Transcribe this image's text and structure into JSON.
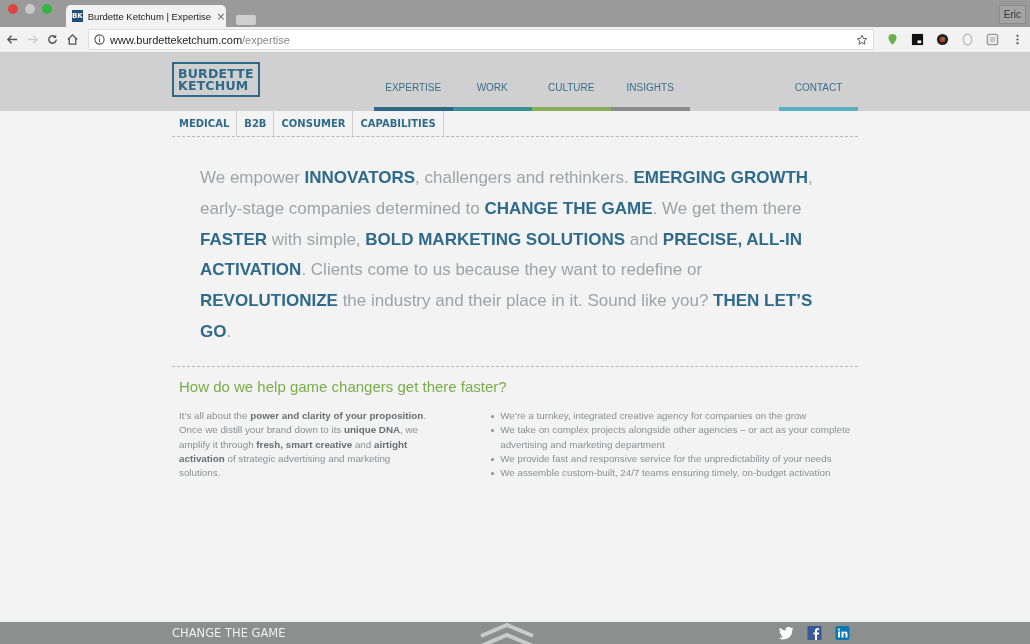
{
  "browser": {
    "tab": {
      "icon_text": "BK",
      "title": "Burdette Ketchum | Expertise",
      "close": "×"
    },
    "profile": "Eric",
    "url": {
      "host": "www.burdetteketchum.com",
      "path": "/expertise"
    }
  },
  "site": {
    "logo": [
      "BURDETTE",
      "KETCHUM"
    ],
    "nav": [
      {
        "label": "EXPERTISE",
        "color": "#2f6787"
      },
      {
        "label": "WORK",
        "color": "#3a8f93"
      },
      {
        "label": "CULTURE",
        "color": "#86ad5a"
      },
      {
        "label": "INSIGHTS",
        "color": "#8c8c8c"
      },
      {
        "label": "CONTACT",
        "color": "#5aaebd"
      }
    ],
    "subnav": [
      "MEDICAL",
      "B2B",
      "CONSUMER",
      "CAPABILITIES"
    ],
    "intro": "We empower **INNOVATORS**, challengers and rethinkers. **EMERGING GROWTH**, early-stage companies determined to **CHANGE THE GAME**. We get them there **FASTER** with simple, **BOLD MARKETING SOLUTIONS** and **PRECISE, ALL-IN ACTIVATION**. Clients come to us because they want to redefine or **REVOLUTIONIZE** the industry and their place in it. Sound like you? **THEN LET’S GO**.",
    "heading": "How do we help game changers get there faster?",
    "body": "It’s all about the **power and clarity of your proposition**. Once we distill your brand down to its **unique DNA**, we amplify it through **fresh, smart creative** and **airtight activation** of strategic advertising and marketing solutions.",
    "bullets": [
      "We’re a turnkey, integrated creative agency for companies on the grow",
      "We take on complex projects alongside other agencies – or act as your complete advertising and marketing department",
      "We provide fast and responsive service for the unpredictability of your needs",
      "We assemble custom-built, 24/7 teams ensuring timely, on-budget activation"
    ],
    "footer": {
      "tagline": "CHANGE THE GAME"
    }
  }
}
